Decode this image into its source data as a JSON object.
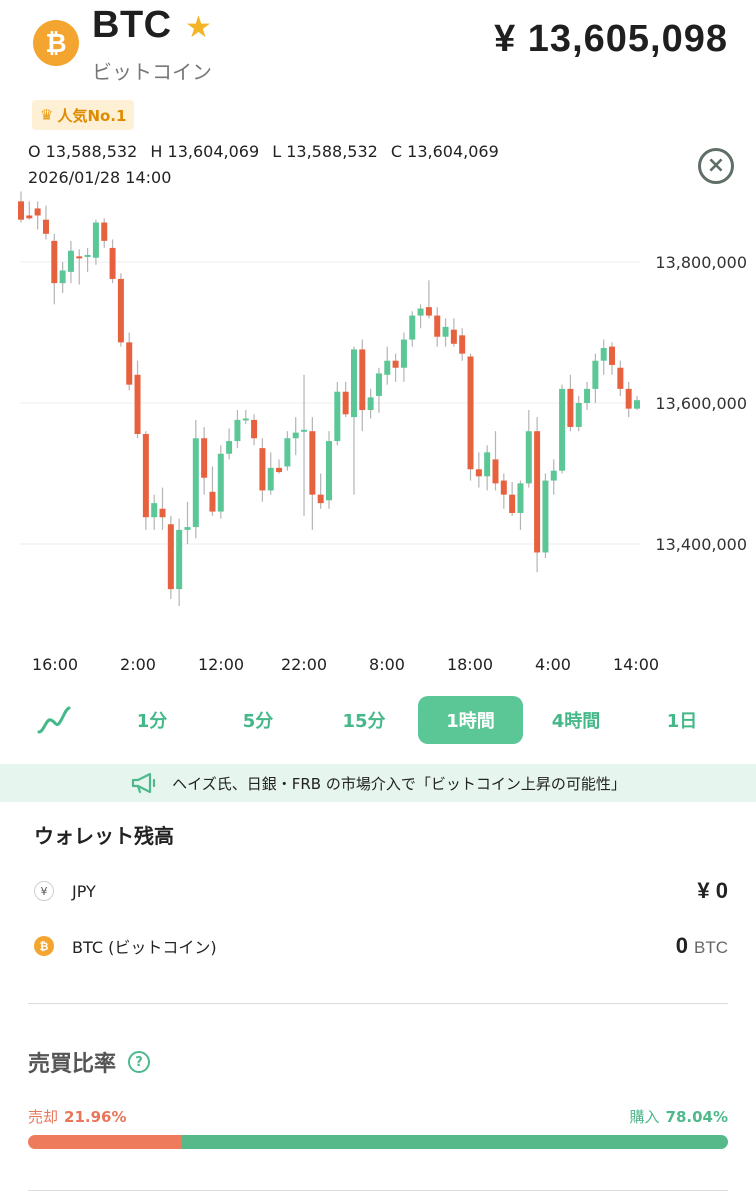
{
  "header": {
    "coin_symbol_icon": "bitcoin-icon",
    "ticker": "BTC",
    "name": "ビットコイン",
    "favorite_icon": "star-icon",
    "price": "¥ 13,605,098"
  },
  "badge": {
    "icon": "crown-icon",
    "label": "人気No.1"
  },
  "ohlc": {
    "open": "O 13,588,532",
    "high": "H 13,604,069",
    "low": "L 13,588,532",
    "close": "C 13,604,069",
    "datetime": "2026/01/28 14:00"
  },
  "close_icon": "close-circle-icon",
  "chart_data": {
    "type": "candlestick",
    "y_ticks": [
      "13,800,000",
      "13,600,000",
      "13,400,000"
    ],
    "y_tick_values": [
      13800000,
      13600000,
      13400000
    ],
    "x_ticks": [
      "16:00",
      "2:00",
      "12:00",
      "22:00",
      "8:00",
      "18:00",
      "4:00",
      "14:00"
    ],
    "colors": {
      "up": "#5cc796",
      "down": "#e8613f",
      "wick": "#b5b5b5",
      "grid": "#ececec"
    },
    "candles": [
      {
        "o": 13886000,
        "h": 13900000,
        "l": 13856000,
        "c": 13860000
      },
      {
        "o": 13866000,
        "h": 13886000,
        "l": 13860000,
        "c": 13862000
      },
      {
        "o": 13876000,
        "h": 13886000,
        "l": 13846000,
        "c": 13866000
      },
      {
        "o": 13860000,
        "h": 13880000,
        "l": 13832000,
        "c": 13840000
      },
      {
        "o": 13830000,
        "h": 13840000,
        "l": 13740000,
        "c": 13770000
      },
      {
        "o": 13770000,
        "h": 13800000,
        "l": 13756000,
        "c": 13788000
      },
      {
        "o": 13786000,
        "h": 13830000,
        "l": 13770000,
        "c": 13816000
      },
      {
        "o": 13808000,
        "h": 13818000,
        "l": 13768000,
        "c": 13806000
      },
      {
        "o": 13808000,
        "h": 13820000,
        "l": 13786000,
        "c": 13810000
      },
      {
        "o": 13806000,
        "h": 13860000,
        "l": 13796000,
        "c": 13856000
      },
      {
        "o": 13856000,
        "h": 13862000,
        "l": 13820000,
        "c": 13830000
      },
      {
        "o": 13820000,
        "h": 13832000,
        "l": 13770000,
        "c": 13776000
      },
      {
        "o": 13776000,
        "h": 13784000,
        "l": 13680000,
        "c": 13686000
      },
      {
        "o": 13686000,
        "h": 13700000,
        "l": 13618000,
        "c": 13626000
      },
      {
        "o": 13640000,
        "h": 13660000,
        "l": 13550000,
        "c": 13556000
      },
      {
        "o": 13556000,
        "h": 13560000,
        "l": 13420000,
        "c": 13438000
      },
      {
        "o": 13438000,
        "h": 13470000,
        "l": 13420000,
        "c": 13458000
      },
      {
        "o": 13450000,
        "h": 13480000,
        "l": 13420000,
        "c": 13438000
      },
      {
        "o": 13428000,
        "h": 13440000,
        "l": 13322000,
        "c": 13336000
      },
      {
        "o": 13336000,
        "h": 13436000,
        "l": 13312000,
        "c": 13420000
      },
      {
        "o": 13420000,
        "h": 13460000,
        "l": 13400000,
        "c": 13424000
      },
      {
        "o": 13424000,
        "h": 13576000,
        "l": 13408000,
        "c": 13550000
      },
      {
        "o": 13550000,
        "h": 13566000,
        "l": 13470000,
        "c": 13494000
      },
      {
        "o": 13474000,
        "h": 13510000,
        "l": 13440000,
        "c": 13446000
      },
      {
        "o": 13446000,
        "h": 13540000,
        "l": 13436000,
        "c": 13528000
      },
      {
        "o": 13528000,
        "h": 13564000,
        "l": 13520000,
        "c": 13546000
      },
      {
        "o": 13546000,
        "h": 13590000,
        "l": 13536000,
        "c": 13576000
      },
      {
        "o": 13576000,
        "h": 13590000,
        "l": 13570000,
        "c": 13578000
      },
      {
        "o": 13576000,
        "h": 13584000,
        "l": 13540000,
        "c": 13550000
      },
      {
        "o": 13536000,
        "h": 13550000,
        "l": 13460000,
        "c": 13476000
      },
      {
        "o": 13476000,
        "h": 13530000,
        "l": 13470000,
        "c": 13508000
      },
      {
        "o": 13508000,
        "h": 13520000,
        "l": 13500000,
        "c": 13502000
      },
      {
        "o": 13510000,
        "h": 13560000,
        "l": 13504000,
        "c": 13550000
      },
      {
        "o": 13550000,
        "h": 13580000,
        "l": 13526000,
        "c": 13558000
      },
      {
        "o": 13560000,
        "h": 13640000,
        "l": 13440000,
        "c": 13562000
      },
      {
        "o": 13560000,
        "h": 13580000,
        "l": 13420000,
        "c": 13470000
      },
      {
        "o": 13470000,
        "h": 13500000,
        "l": 13450000,
        "c": 13458000
      },
      {
        "o": 13462000,
        "h": 13560000,
        "l": 13450000,
        "c": 13546000
      },
      {
        "o": 13546000,
        "h": 13630000,
        "l": 13540000,
        "c": 13616000
      },
      {
        "o": 13616000,
        "h": 13630000,
        "l": 13580000,
        "c": 13584000
      },
      {
        "o": 13580000,
        "h": 13680000,
        "l": 13470000,
        "c": 13676000
      },
      {
        "o": 13676000,
        "h": 13690000,
        "l": 13560000,
        "c": 13590000
      },
      {
        "o": 13590000,
        "h": 13620000,
        "l": 13578000,
        "c": 13608000
      },
      {
        "o": 13610000,
        "h": 13650000,
        "l": 13586000,
        "c": 13642000
      },
      {
        "o": 13640000,
        "h": 13680000,
        "l": 13626000,
        "c": 13660000
      },
      {
        "o": 13660000,
        "h": 13670000,
        "l": 13630000,
        "c": 13650000
      },
      {
        "o": 13650000,
        "h": 13700000,
        "l": 13630000,
        "c": 13690000
      },
      {
        "o": 13690000,
        "h": 13730000,
        "l": 13680000,
        "c": 13724000
      },
      {
        "o": 13724000,
        "h": 13740000,
        "l": 13706000,
        "c": 13734000
      },
      {
        "o": 13736000,
        "h": 13774000,
        "l": 13720000,
        "c": 13724000
      },
      {
        "o": 13724000,
        "h": 13736000,
        "l": 13680000,
        "c": 13694000
      },
      {
        "o": 13694000,
        "h": 13720000,
        "l": 13680000,
        "c": 13708000
      },
      {
        "o": 13704000,
        "h": 13720000,
        "l": 13680000,
        "c": 13684000
      },
      {
        "o": 13696000,
        "h": 13706000,
        "l": 13660000,
        "c": 13670000
      },
      {
        "o": 13666000,
        "h": 13670000,
        "l": 13490000,
        "c": 13506000
      },
      {
        "o": 13506000,
        "h": 13530000,
        "l": 13480000,
        "c": 13496000
      },
      {
        "o": 13496000,
        "h": 13540000,
        "l": 13476000,
        "c": 13530000
      },
      {
        "o": 13520000,
        "h": 13560000,
        "l": 13476000,
        "c": 13486000
      },
      {
        "o": 13490000,
        "h": 13500000,
        "l": 13450000,
        "c": 13470000
      },
      {
        "o": 13470000,
        "h": 13488000,
        "l": 13440000,
        "c": 13444000
      },
      {
        "o": 13444000,
        "h": 13490000,
        "l": 13420000,
        "c": 13486000
      },
      {
        "o": 13486000,
        "h": 13590000,
        "l": 13480000,
        "c": 13560000
      },
      {
        "o": 13560000,
        "h": 13580000,
        "l": 13360000,
        "c": 13388000
      },
      {
        "o": 13388000,
        "h": 13500000,
        "l": 13380000,
        "c": 13490000
      },
      {
        "o": 13490000,
        "h": 13520000,
        "l": 13470000,
        "c": 13504000
      },
      {
        "o": 13504000,
        "h": 13626000,
        "l": 13500000,
        "c": 13620000
      },
      {
        "o": 13620000,
        "h": 13640000,
        "l": 13560000,
        "c": 13566000
      },
      {
        "o": 13566000,
        "h": 13610000,
        "l": 13560000,
        "c": 13600000
      },
      {
        "o": 13600000,
        "h": 13630000,
        "l": 13590000,
        "c": 13620000
      },
      {
        "o": 13620000,
        "h": 13670000,
        "l": 13600000,
        "c": 13660000
      },
      {
        "o": 13660000,
        "h": 13690000,
        "l": 13640000,
        "c": 13678000
      },
      {
        "o": 13680000,
        "h": 13686000,
        "l": 13640000,
        "c": 13654000
      },
      {
        "o": 13650000,
        "h": 13660000,
        "l": 13610000,
        "c": 13620000
      },
      {
        "o": 13620000,
        "h": 13630000,
        "l": 13580000,
        "c": 13592000
      },
      {
        "o": 13592000,
        "h": 13610000,
        "l": 13590000,
        "c": 13604000
      }
    ]
  },
  "timeframes": {
    "line_icon": "line-chart-icon",
    "items": [
      "1分",
      "5分",
      "15分",
      "1時間",
      "4時間",
      "1日"
    ],
    "active": "1時間"
  },
  "news": {
    "icon": "megaphone-icon",
    "text": "ヘイズ氏、日銀・FRB の市場介入で「ビットコイン上昇の可能性」"
  },
  "wallet": {
    "title": "ウォレット残高",
    "rows": [
      {
        "icon": "yen-icon",
        "icon_glyph": "¥",
        "label": "JPY",
        "value": "¥ 0",
        "unit": ""
      },
      {
        "icon": "bitcoin-icon",
        "icon_glyph": "₿",
        "label": "BTC (ビットコイン)",
        "value": "0",
        "unit": "BTC"
      }
    ]
  },
  "ratio": {
    "title": "売買比率",
    "help_icon": "help-icon",
    "sell_label": "売却",
    "sell_value": "21.96%",
    "sell_fraction": 0.2196,
    "buy_label": "購入",
    "buy_value": "78.04%",
    "buy_fraction": 0.7804,
    "colors": {
      "sell": "#ef7b5d",
      "buy": "#55b98a"
    }
  }
}
